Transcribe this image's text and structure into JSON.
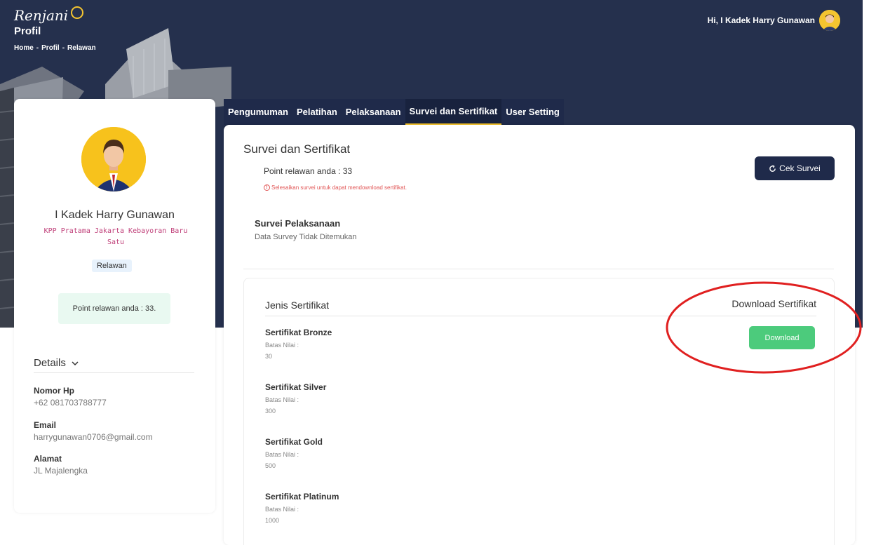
{
  "header": {
    "logo_text": "Renjani",
    "page_title": "Profil",
    "breadcrumb": [
      "Home",
      "Profil",
      "Relawan"
    ],
    "breadcrumb_sep": "-",
    "greeting": "Hi, I Kadek Harry Gunawan"
  },
  "profile": {
    "name": "I Kadek Harry Gunawan",
    "office": "KPP Pratama Jakarta Kebayoran Baru Satu",
    "role": "Relawan",
    "point_text": "Point relawan anda : 33.",
    "details_label": "Details",
    "fields": [
      {
        "label": "Nomor Hp",
        "value": "+62 081703788777"
      },
      {
        "label": "Email",
        "value": "harrygunawan0706@gmail.com"
      },
      {
        "label": "Alamat",
        "value": "JL Majalengka"
      }
    ]
  },
  "tabs": [
    {
      "label": "Pengumuman",
      "active": false
    },
    {
      "label": "Pelatihan",
      "active": false
    },
    {
      "label": "Pelaksanaan",
      "active": false
    },
    {
      "label": "Survei dan Sertifikat",
      "active": true
    },
    {
      "label": "User Setting",
      "active": false
    }
  ],
  "main": {
    "title": "Survei dan Sertifikat",
    "point_label": "Point relawan anda : ",
    "point_value": "33",
    "warning": "Selesaikan survei untuk dapat mendownload sertifikat.",
    "cek_button": "Cek Survei",
    "survey_title": "Survei Pelaksanaan",
    "survey_empty": "Data Survey Tidak Ditemukan",
    "cert_header_left": "Jenis Sertifikat",
    "cert_header_right": "Download Sertifikat",
    "download_button": "Download",
    "certificates": [
      {
        "name": "Sertifikat Bronze",
        "label": "Batas Nilai :",
        "value": "30"
      },
      {
        "name": "Sertifikat Silver",
        "label": "Batas Nilai :",
        "value": "300"
      },
      {
        "name": "Sertifikat Gold",
        "label": "Batas Nilai :",
        "value": "500"
      },
      {
        "name": "Sertifikat Platinum",
        "label": "Batas Nilai :",
        "value": "1000"
      }
    ]
  },
  "colors": {
    "navy": "#1f2a4a",
    "green": "#4ccb7c",
    "annotation_red": "#e02020",
    "accent_yellow": "#f4c430"
  }
}
